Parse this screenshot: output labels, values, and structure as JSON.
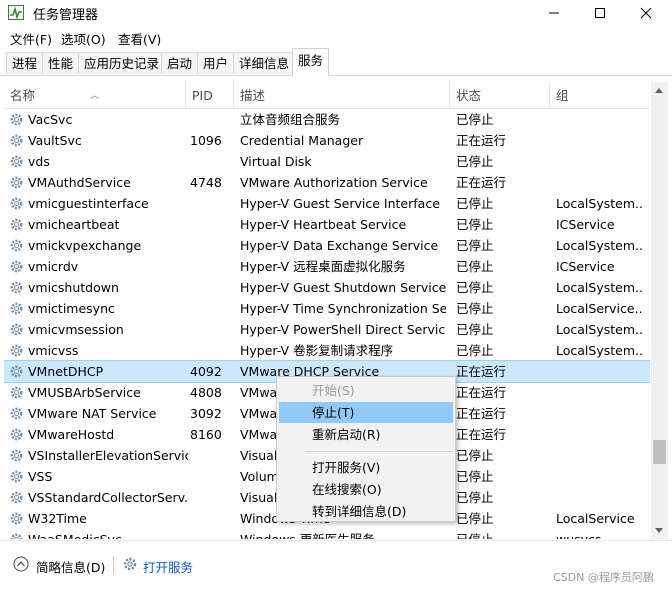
{
  "window": {
    "title": "任务管理器",
    "icon": "task-manager-icon"
  },
  "menu": [
    "文件(F)",
    "选项(O)",
    "查看(V)"
  ],
  "tabs": [
    {
      "label": "进程",
      "active": false
    },
    {
      "label": "性能",
      "active": false
    },
    {
      "label": "应用历史记录",
      "active": false
    },
    {
      "label": "启动",
      "active": false
    },
    {
      "label": "用户",
      "active": false
    },
    {
      "label": "详细信息",
      "active": false
    },
    {
      "label": "服务",
      "active": true
    }
  ],
  "columns": [
    "名称",
    "PID",
    "描述",
    "状态",
    "组"
  ],
  "rows": [
    {
      "name": "VacSvc",
      "pid": "",
      "desc": "立体音频组合服务",
      "status": "已停止",
      "group": ""
    },
    {
      "name": "VaultSvc",
      "pid": "1096",
      "desc": "Credential Manager",
      "status": "正在运行",
      "group": ""
    },
    {
      "name": "vds",
      "pid": "",
      "desc": "Virtual Disk",
      "status": "已停止",
      "group": ""
    },
    {
      "name": "VMAuthdService",
      "pid": "4748",
      "desc": "VMware Authorization Service",
      "status": "正在运行",
      "group": ""
    },
    {
      "name": "vmicguestinterface",
      "pid": "",
      "desc": "Hyper-V Guest Service Interface",
      "status": "已停止",
      "group": "LocalSystem..."
    },
    {
      "name": "vmicheartbeat",
      "pid": "",
      "desc": "Hyper-V Heartbeat Service",
      "status": "已停止",
      "group": "ICService"
    },
    {
      "name": "vmickvpexchange",
      "pid": "",
      "desc": "Hyper-V Data Exchange Service",
      "status": "已停止",
      "group": "LocalSystem..."
    },
    {
      "name": "vmicrdv",
      "pid": "",
      "desc": "Hyper-V 远程桌面虚拟化服务",
      "status": "已停止",
      "group": "ICService"
    },
    {
      "name": "vmicshutdown",
      "pid": "",
      "desc": "Hyper-V Guest Shutdown Service",
      "status": "已停止",
      "group": "LocalSystem..."
    },
    {
      "name": "vmictimesync",
      "pid": "",
      "desc": "Hyper-V Time Synchronization Se...",
      "status": "已停止",
      "group": "LocalService..."
    },
    {
      "name": "vmicvmsession",
      "pid": "",
      "desc": "Hyper-V PowerShell Direct Service",
      "status": "已停止",
      "group": "LocalSystem..."
    },
    {
      "name": "vmicvss",
      "pid": "",
      "desc": "Hyper-V 卷影复制请求程序",
      "status": "已停止",
      "group": "LocalSystem..."
    },
    {
      "name": "VMnetDHCP",
      "pid": "4092",
      "desc": "VMware DHCP Service",
      "status": "正在运行",
      "group": "",
      "selected": true
    },
    {
      "name": "VMUSBArbService",
      "pid": "4808",
      "desc": "VMwa",
      "status": "正在运行",
      "group": ""
    },
    {
      "name": "VMware NAT Service",
      "pid": "3092",
      "desc": "VMwa",
      "status": "正在运行",
      "group": ""
    },
    {
      "name": "VMwareHostd",
      "pid": "8160",
      "desc": "VMwa",
      "status": "正在运行",
      "group": ""
    },
    {
      "name": "VSInstallerElevationService",
      "pid": "",
      "desc": "Visual",
      "status": "已停止",
      "group": ""
    },
    {
      "name": "VSS",
      "pid": "",
      "desc": "Volum",
      "status": "已停止",
      "group": ""
    },
    {
      "name": "VSStandardCollectorServ...",
      "pid": "",
      "desc": "Visual",
      "status": "已停止",
      "group": ""
    },
    {
      "name": "W32Time",
      "pid": "",
      "desc": "Windows Time",
      "status": "已停止",
      "group": "LocalService"
    },
    {
      "name": "WaaSMedicSvc",
      "pid": "",
      "desc": "Windows 更新医生服务",
      "status": "已停止",
      "group": "wusvcs"
    }
  ],
  "context_menu": [
    {
      "label": "开始(S)",
      "disabled": true
    },
    {
      "label": "停止(T)",
      "hover": true
    },
    {
      "label": "重新启动(R)"
    },
    {
      "separator": true
    },
    {
      "label": "打开服务(V)"
    },
    {
      "label": "在线搜索(O)"
    },
    {
      "label": "转到详细信息(D)"
    }
  ],
  "footer": {
    "less_details": "简略信息(D)",
    "open_services": "打开服务"
  },
  "watermark": "CSDN @程序员阿鹏",
  "colors": {
    "selected_row": "#cce8ff",
    "menu_hover": "#91c9f7",
    "link": "#0b5fc7"
  }
}
